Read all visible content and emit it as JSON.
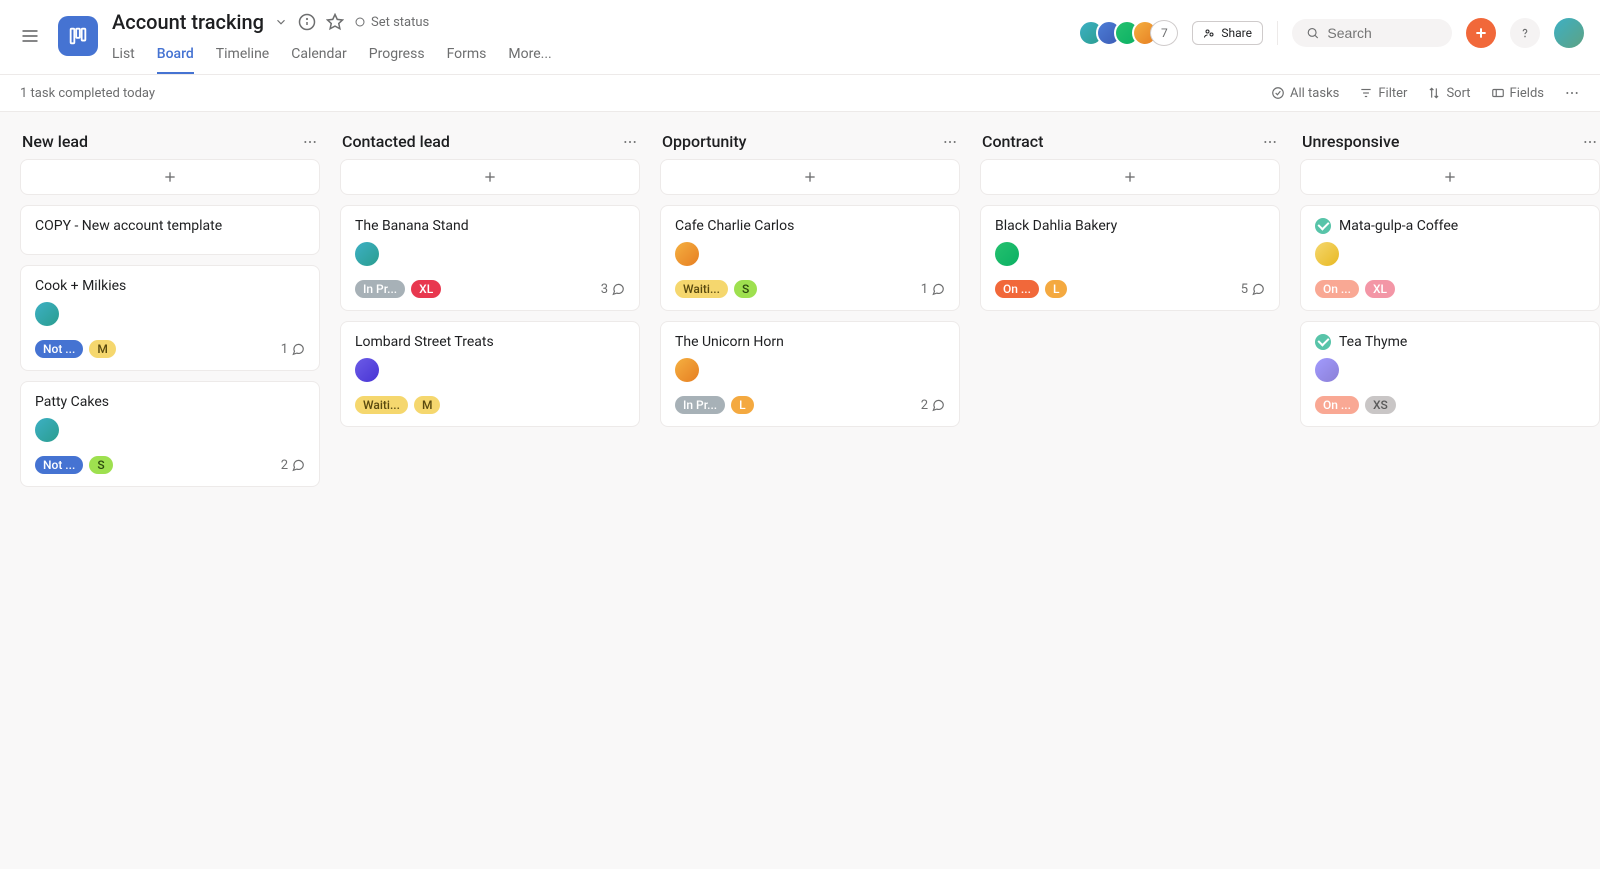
{
  "header": {
    "title": "Account tracking",
    "set_status": "Set status",
    "tabs": [
      "List",
      "Board",
      "Timeline",
      "Calendar",
      "Progress",
      "Forms",
      "More..."
    ],
    "active_tab": "Board",
    "member_count": "7",
    "share_label": "Share",
    "search_placeholder": "Search"
  },
  "toolbar": {
    "status_text": "1 task completed today",
    "all_tasks": "All tasks",
    "filter": "Filter",
    "sort": "Sort",
    "fields": "Fields"
  },
  "columns": [
    {
      "title": "New lead",
      "cards": [
        {
          "title": "COPY - New account template",
          "completed": false,
          "avatar": null,
          "pills": [],
          "comments": null
        },
        {
          "title": "Cook + Milkies",
          "completed": false,
          "avatar": "av-teal",
          "pills": [
            {
              "text": "Not ...",
              "bg": "#4573d2",
              "fg": "#fff"
            },
            {
              "text": "M",
              "bg": "#f5d76e",
              "fg": "#5a4a0f"
            }
          ],
          "comments": 1
        },
        {
          "title": "Patty Cakes",
          "completed": false,
          "avatar": "av-teal",
          "pills": [
            {
              "text": "Not ...",
              "bg": "#4573d2",
              "fg": "#fff"
            },
            {
              "text": "S",
              "bg": "#9ee04f",
              "fg": "#2d4a0f"
            }
          ],
          "comments": 2
        }
      ]
    },
    {
      "title": "Contacted lead",
      "cards": [
        {
          "title": "The Banana Stand",
          "completed": false,
          "avatar": "av-teal",
          "pills": [
            {
              "text": "In Pr...",
              "bg": "#a7b1b7",
              "fg": "#fff"
            },
            {
              "text": "XL",
              "bg": "#e8384f",
              "fg": "#fff"
            }
          ],
          "comments": 3
        },
        {
          "title": "Lombard Street Treats",
          "completed": false,
          "avatar": "av-purple",
          "pills": [
            {
              "text": "Waiti...",
              "bg": "#f5d76e",
              "fg": "#5a4a0f"
            },
            {
              "text": "M",
              "bg": "#f5d76e",
              "fg": "#5a4a0f"
            }
          ],
          "comments": null
        }
      ]
    },
    {
      "title": "Opportunity",
      "cards": [
        {
          "title": "Cafe Charlie Carlos",
          "completed": false,
          "avatar": "av-orange",
          "pills": [
            {
              "text": "Waiti...",
              "bg": "#f5d76e",
              "fg": "#5a4a0f"
            },
            {
              "text": "S",
              "bg": "#9ee04f",
              "fg": "#2d4a0f"
            }
          ],
          "comments": 1
        },
        {
          "title": "The Unicorn Horn",
          "completed": false,
          "avatar": "av-orange",
          "pills": [
            {
              "text": "In Pr...",
              "bg": "#a7b1b7",
              "fg": "#fff"
            },
            {
              "text": "L",
              "bg": "#f4a940",
              "fg": "#fff"
            }
          ],
          "comments": 2
        }
      ]
    },
    {
      "title": "Contract",
      "cards": [
        {
          "title": "Black Dahlia Bakery",
          "completed": false,
          "avatar": "av-green",
          "pills": [
            {
              "text": "On ...",
              "bg": "#f1683a",
              "fg": "#fff"
            },
            {
              "text": "L",
              "bg": "#f4a940",
              "fg": "#fff"
            }
          ],
          "comments": 5
        }
      ]
    },
    {
      "title": "Unresponsive",
      "cards": [
        {
          "title": "Mata-gulp-a Coffee",
          "completed": true,
          "avatar": "av-yellow",
          "pills": [
            {
              "text": "On ...",
              "bg": "#f9a894",
              "fg": "#fff"
            },
            {
              "text": "XL",
              "bg": "#f396a6",
              "fg": "#fff"
            }
          ],
          "comments": null
        },
        {
          "title": "Tea Thyme",
          "completed": true,
          "avatar": "av-lav",
          "pills": [
            {
              "text": "On ...",
              "bg": "#f9a894",
              "fg": "#fff"
            },
            {
              "text": "XS",
              "bg": "#c9c6c6",
              "fg": "#5a5a5a"
            }
          ],
          "comments": null
        }
      ]
    }
  ]
}
